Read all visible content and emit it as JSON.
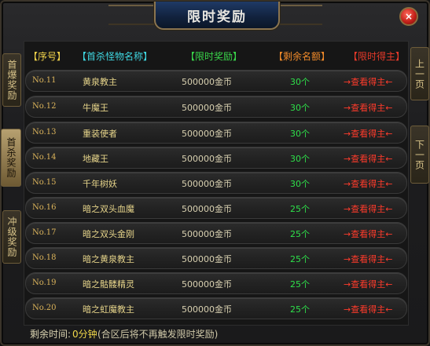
{
  "window": {
    "title": "限时奖励",
    "close_label": "×"
  },
  "header": {
    "idx": "【序号】",
    "name": "【首杀怪物名称】",
    "reward": "【限时奖励】",
    "remain": "【剩余名额】",
    "winner": "【限时得主】"
  },
  "left_tabs": [
    {
      "label": "首爆奖励",
      "active": false
    },
    {
      "label": "首杀奖励",
      "active": true
    },
    {
      "label": "冲级奖励",
      "active": false
    }
  ],
  "right_nav": {
    "prev": "上一页",
    "next": "下一页"
  },
  "rows": [
    {
      "idx": "No.11",
      "name": "黄泉教主",
      "reward": "500000金币",
      "remain": "30个",
      "winner": "→查看得主←"
    },
    {
      "idx": "No.12",
      "name": "牛魔王",
      "reward": "500000金币",
      "remain": "30个",
      "winner": "→查看得主←"
    },
    {
      "idx": "No.13",
      "name": "重装使者",
      "reward": "500000金币",
      "remain": "30个",
      "winner": "→查看得主←"
    },
    {
      "idx": "No.14",
      "name": "地藏王",
      "reward": "500000金币",
      "remain": "30个",
      "winner": "→查看得主←"
    },
    {
      "idx": "No.15",
      "name": "千年树妖",
      "reward": "500000金币",
      "remain": "30个",
      "winner": "→查看得主←"
    },
    {
      "idx": "No.16",
      "name": "暗之双头血魔",
      "reward": "500000金币",
      "remain": "25个",
      "winner": "→查看得主←"
    },
    {
      "idx": "No.17",
      "name": "暗之双头金刚",
      "reward": "500000金币",
      "remain": "25个",
      "winner": "→查看得主←"
    },
    {
      "idx": "No.18",
      "name": "暗之黄泉教主",
      "reward": "500000金币",
      "remain": "25个",
      "winner": "→查看得主←"
    },
    {
      "idx": "No.19",
      "name": "暗之骷髅精灵",
      "reward": "500000金币",
      "remain": "25个",
      "winner": "→查看得主←"
    },
    {
      "idx": "No.20",
      "name": "暗之虹魔教主",
      "reward": "500000金币",
      "remain": "25个",
      "winner": "→查看得主←"
    }
  ],
  "footer": {
    "label": "剩余时间:",
    "value": "0分钟",
    "note": "(合区后将不再触发限时奖励)"
  }
}
